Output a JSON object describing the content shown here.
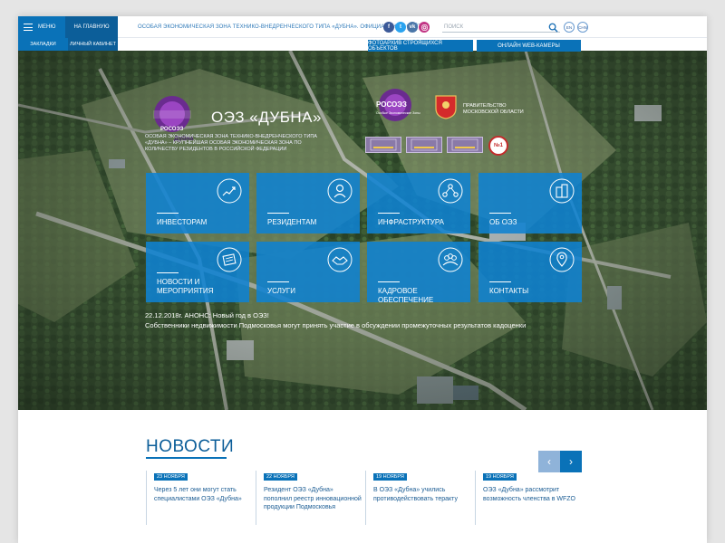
{
  "header": {
    "menu_label": "МЕНЮ",
    "home_label": "НА ГЛАВНУЮ",
    "bookmarks_label": "ЗАКЛАДКИ",
    "cabinet_label": "ЛИЧНЫЙ КАБИНЕТ",
    "site_title": "ОСОБАЯ ЭКОНОМИЧЕСКАЯ ЗОНА ТЕХНИКО-ВНЕДРЕНЧЕСКОГО ТИПА «ДУБНА». ОФИЦИАЛЬНЫЙ САЙТ",
    "search_placeholder": "ПОИСК",
    "lang_en": "EN",
    "lang_chn": "CHN",
    "social_icons": [
      "facebook-icon",
      "twitter-icon",
      "vk-icon",
      "instagram-icon"
    ],
    "photo_archive": "ФОТОАРХИВ СТРОЯЩИХСЯ ОБЪЕКТОВ",
    "webcams": "ОНЛАЙН WEB-КАМЕРЫ"
  },
  "hero": {
    "logo_left_brand": "РОСОЭЗ",
    "logo_left_sub": "Дубна",
    "title": "ОЭЗ «ДУБНА»",
    "description": "ОСОБАЯ ЭКОНОМИЧЕСКАЯ ЗОНА ТЕХНИКО-ВНЕДРЕНЧЕСКОГО ТИПА «ДУБНА» – КРУПНЕЙШАЯ ОСОБАЯ ЭКОНОМИЧЕСКАЯ ЗОНА ПО КОЛИЧЕСТВУ РЕЗИДЕНТОВ В РОССИЙСКОЙ ФЕДЕРАЦИИ",
    "logo_right_brand": "РОСОЭЗ",
    "logo_right_sub": "Особые Экономические Зоны",
    "gov_line1": "ПРАВИТЕЛЬСТВО",
    "gov_line2": "МОСКОВСКОЙ ОБЛАСТИ",
    "badge_n1": "№1",
    "colors": {
      "accent": "#0a72b8",
      "tile": "#0f82d2",
      "dark_accent": "#0c5e99"
    }
  },
  "tiles": [
    {
      "label": "ИНВЕСТОРАМ",
      "icon": "chart-growth-icon"
    },
    {
      "label": "РЕЗИДЕНТАМ",
      "icon": "person-icon"
    },
    {
      "label": "ИНФРАСТРУКТУРА",
      "icon": "network-nodes-icon"
    },
    {
      "label": "ОБ ОЭЗ",
      "icon": "buildings-icon"
    },
    {
      "label": "НОВОСТИ И МЕРОПРИЯТИЯ",
      "icon": "newspaper-icon"
    },
    {
      "label": "УСЛУГИ",
      "icon": "handshake-icon"
    },
    {
      "label": "КАДРОВОЕ ОБЕСПЕЧЕНИЕ",
      "icon": "people-icon"
    },
    {
      "label": "КОНТАКТЫ",
      "icon": "location-pin-icon"
    }
  ],
  "ticker": [
    "22.12.2018г. АНОНС: Новый год в ОЭЗ!",
    "Собственники недвижимости Подмосковья могут принять участие в обсуждении промежуточных результатов кадоценки"
  ],
  "news": {
    "heading": "НОВОСТИ",
    "prev_icon": "chevron-left-icon",
    "next_icon": "chevron-right-icon",
    "items": [
      {
        "date": "23 НОЯБРЯ",
        "text": "Через 5 лет они могут стать специалистами ОЭЗ «Дубна»"
      },
      {
        "date": "22 НОЯБРЯ",
        "text": "Резидент ОЭЗ «Дубна» пополнил реестр инновационной продукции Подмосковья"
      },
      {
        "date": "19 НОЯБРЯ",
        "text": "В ОЭЗ «Дубна» учились противодействовать теракту"
      },
      {
        "date": "19 НОЯБРЯ",
        "text": "ОЭЗ «Дубна» рассмотрит возможность членства в WFZO"
      }
    ]
  }
}
